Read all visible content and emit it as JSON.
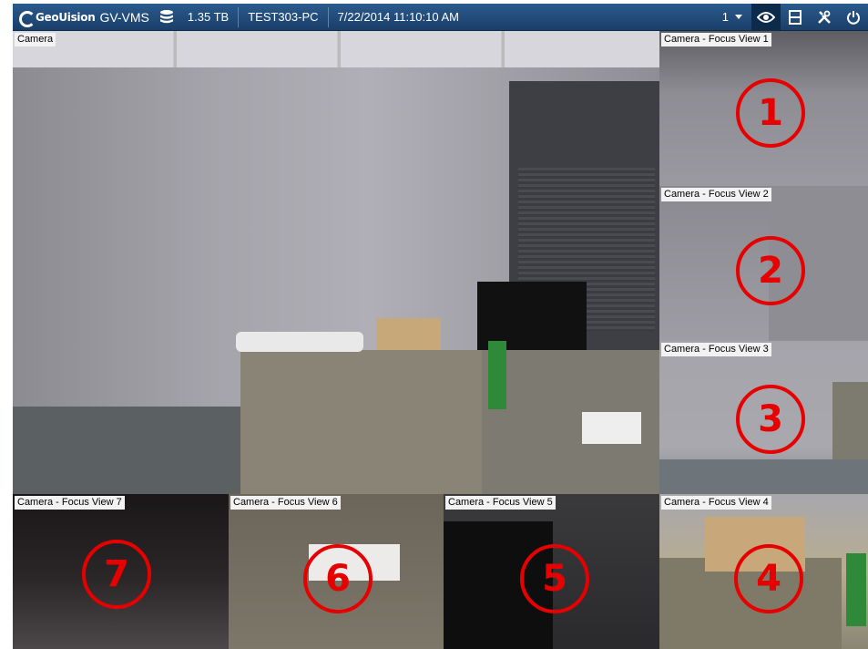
{
  "toolbar": {
    "brand": "GeoUision",
    "product": "GV-VMS",
    "storage": "1.35 TB",
    "host": "TEST303-PC",
    "datetime": "7/22/2014 11:10:10 AM",
    "page_selector": "1",
    "icons": [
      "database-icon",
      "eye-icon",
      "layout-icon",
      "tools-icon",
      "power-icon"
    ]
  },
  "views": {
    "main": {
      "label": "Camera"
    },
    "focus_1": {
      "label": "Camera - Focus View 1",
      "number": "1"
    },
    "focus_2": {
      "label": "Camera - Focus View 2",
      "number": "2"
    },
    "focus_3": {
      "label": "Camera - Focus View 3",
      "number": "3"
    },
    "focus_4": {
      "label": "Camera - Focus View 4",
      "number": "4"
    },
    "focus_5": {
      "label": "Camera - Focus View 5",
      "number": "5"
    },
    "focus_6": {
      "label": "Camera - Focus View 6",
      "number": "6"
    },
    "focus_7": {
      "label": "Camera - Focus View 7",
      "number": "7"
    }
  },
  "colors": {
    "toolbar": "#1f4a7a",
    "annotation": "#e60000",
    "label_bg": "#f2f2f2"
  }
}
